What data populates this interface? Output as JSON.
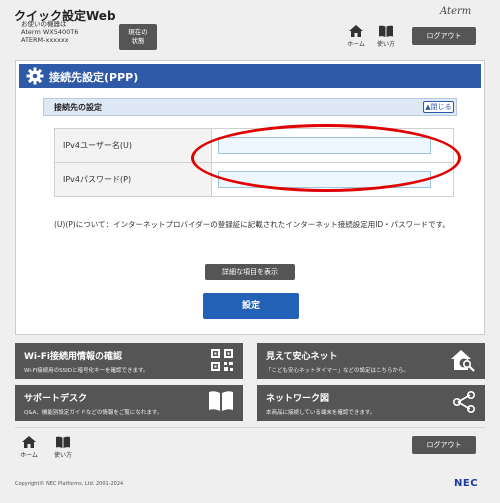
{
  "header": {
    "app_title": "クイック設定Web",
    "device_lines": [
      "お使いの機器は",
      "Aterm WX5400T6",
      "ATERM-xxxxxx"
    ],
    "status_button": [
      "現在の",
      "状態"
    ],
    "brand": "Aterm",
    "home_label": "ホーム",
    "help_label": "使い方",
    "logout_label": "ログアウト"
  },
  "panel": {
    "title": "接続先設定(PPP)",
    "section_label": "接続先の設定",
    "close_label": "▲閉じる",
    "fields": [
      {
        "label": "IPv4ユーザー名(U)",
        "value": ""
      },
      {
        "label": "IPv4パスワード(P)",
        "value": ""
      }
    ],
    "note": "(U)(P)について：インターネットプロバイダーの登録証に記載されたインターネット接続設定用ID・パスワードです。",
    "detail_button": "詳細な項目を表示",
    "apply_button": "設定"
  },
  "tiles": [
    {
      "title": "Wi-Fi接続用情報の確認",
      "desc": "Wi-Fi接続用のSSIDと暗号化キーを確認できます。",
      "icon": "qr-code-icon"
    },
    {
      "title": "見えて安心ネット",
      "desc": "「こども安心ネットタイマー」などの設定はこちらから。",
      "icon": "home-search-icon"
    },
    {
      "title": "サポートデスク",
      "desc": "Q&A、機能別設定ガイドなどの情報をご覧になれます。",
      "icon": "book-icon"
    },
    {
      "title": "ネットワーク図",
      "desc": "本商品に接続している端末を確認できます。",
      "icon": "network-icon"
    }
  ],
  "footer": {
    "home_label": "ホーム",
    "help_label": "使い方",
    "logout_label": "ログアウト",
    "copyright": "Copyright© NEC Platforms, Ltd. 2001-2024",
    "logo": "NEC"
  },
  "colors": {
    "accent_blue": "#2f5aa8",
    "button_blue": "#2462b8",
    "dark_gray": "#555555",
    "highlight_red": "#e00000"
  }
}
